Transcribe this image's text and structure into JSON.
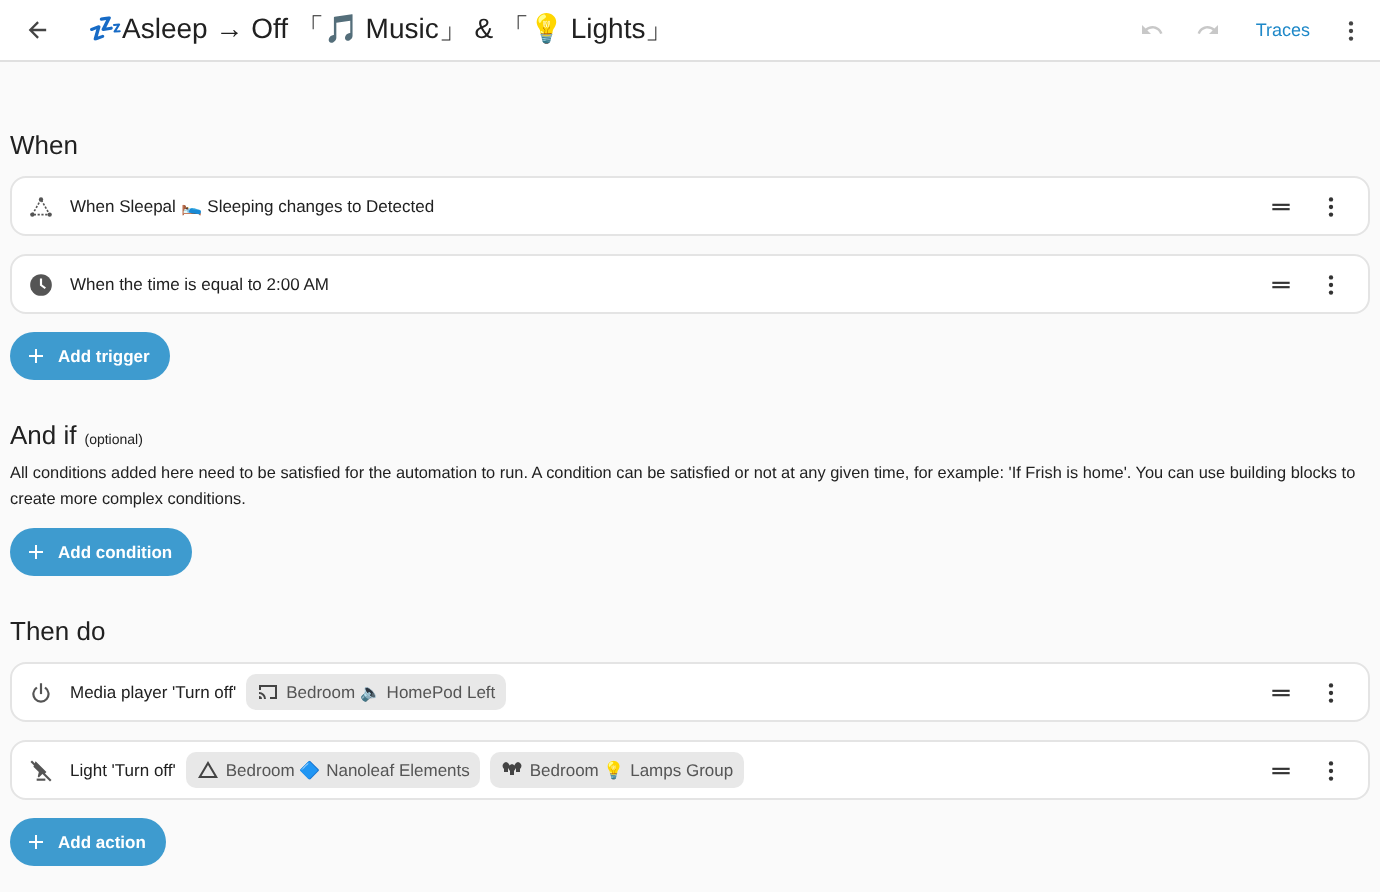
{
  "header": {
    "title": "💤Asleep → Off 「🎵 Music」 & 「💡 Lights」",
    "undo_disabled": true,
    "redo_disabled": true,
    "traces": "Traces"
  },
  "triggers": {
    "heading": "When",
    "items": [
      {
        "kind": "state",
        "text": "When Sleepal 🛌 Sleeping changes to Detected"
      },
      {
        "kind": "time",
        "text": "When the time is equal to 2:00 AM"
      }
    ],
    "add_button": "Add trigger"
  },
  "conditions": {
    "heading": "And if",
    "note": "(optional)",
    "description": "All conditions added here need to be satisfied for the automation to run. A condition can be satisfied or not at any given time, for example: 'If Frish is home'. You can use building blocks to create more complex conditions.",
    "add_button": "Add condition"
  },
  "actions": {
    "heading": "Then do",
    "items": [
      {
        "kind": "media_player",
        "text": "Media player 'Turn off'",
        "targets": [
          {
            "kind": "cast",
            "label": "Bedroom 🔈 HomePod Left"
          }
        ]
      },
      {
        "kind": "light",
        "text": "Light 'Turn off'",
        "targets": [
          {
            "kind": "triangle",
            "label": "Bedroom 🔷 Nanoleaf Elements"
          },
          {
            "kind": "group",
            "label": "Bedroom 💡 Lamps Group"
          }
        ]
      }
    ],
    "add_button": "Add action"
  }
}
